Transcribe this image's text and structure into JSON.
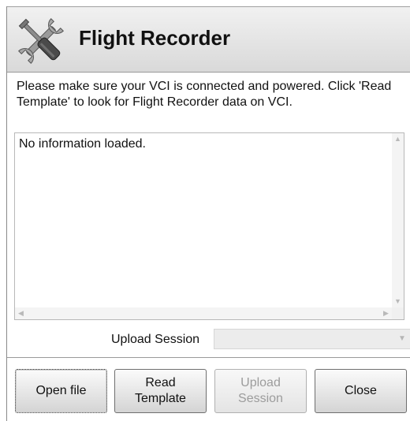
{
  "header": {
    "icon": "tools-icon",
    "title": "Flight Recorder"
  },
  "instructions": "Please make sure your VCI is connected and powered. Click 'Read Template' to look for Flight Recorder data on VCI.",
  "info_box": {
    "content": "No information loaded."
  },
  "upload_session": {
    "label": "Upload Session",
    "selected_value": ""
  },
  "buttons": {
    "open_file": "Open file",
    "read_template": "Read\nTemplate",
    "upload_session": "Upload\nSession",
    "close": "Close"
  },
  "colors": {
    "header_gradient_top": "#f1f1f1",
    "header_gradient_bottom": "#d9d9d9",
    "icon_handle": "#4a4a4a",
    "disabled_text": "#9c9c9c"
  }
}
